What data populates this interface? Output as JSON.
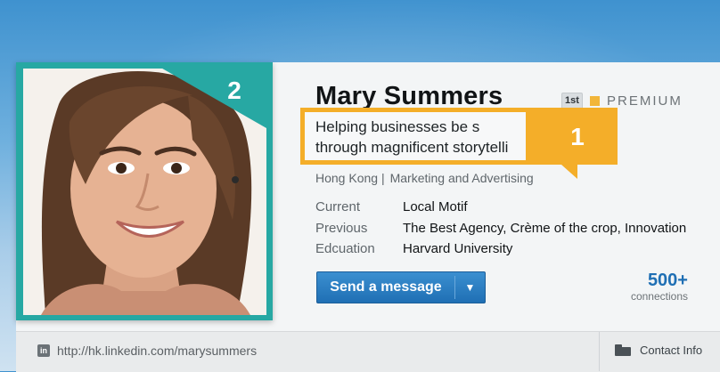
{
  "profile": {
    "name": "Mary Summers",
    "degree": "1st",
    "premium_label": "PREMIUM",
    "headline_line1": "Helping businesses be s",
    "headline_line2": "through magnificent storytelli",
    "location": "Hong Kong |",
    "industry": "Marketing and Advertising",
    "details": [
      {
        "label": "Current",
        "value": "Local Motif"
      },
      {
        "label": "Previous",
        "value": "The Best Agency, Crème of the crop, Innovation"
      },
      {
        "label": "Edcuation",
        "value": "Harvard University"
      }
    ],
    "send_message_label": "Send a message",
    "connections_count": "500+",
    "connections_label": "connections",
    "profile_url": "http://hk.linkedin.com/marysummers",
    "contact_info_label": "Contact Info"
  },
  "callouts": {
    "photo_badge": "2",
    "headline_badge": "1"
  },
  "colors": {
    "teal_frame": "#27a8a3",
    "callout_orange": "#f4ae29",
    "button_blue": "#1f6fb4",
    "premium_gold": "#f2b63a"
  },
  "icons": {
    "linkedin": "linkedin-icon",
    "folder": "folder-icon",
    "dropdown": "chevron-down-icon"
  }
}
